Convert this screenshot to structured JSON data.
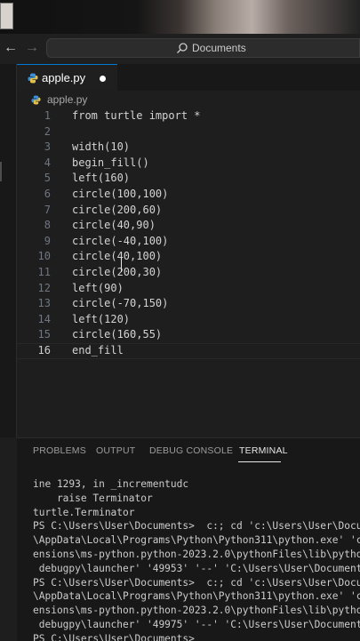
{
  "titlebar": {
    "back_icon": "arrow-left-icon",
    "forward_icon": "arrow-right-icon",
    "search_text": "Documents"
  },
  "tabs": [
    {
      "label": "apple.py",
      "modified": true
    }
  ],
  "breadcrumb": {
    "label": "apple.py"
  },
  "editor": {
    "lines": [
      {
        "n": "1",
        "code": "from turtle import *"
      },
      {
        "n": "2",
        "code": ""
      },
      {
        "n": "3",
        "code": "width(10)"
      },
      {
        "n": "4",
        "code": "begin_fill()"
      },
      {
        "n": "5",
        "code": "left(160)"
      },
      {
        "n": "6",
        "code": "circle(100,100)"
      },
      {
        "n": "7",
        "code": "circle(200,60)"
      },
      {
        "n": "8",
        "code": "circle(40,90)"
      },
      {
        "n": "9",
        "code": "circle(-40,100)"
      },
      {
        "n": "10",
        "code": "circle(40,100)"
      },
      {
        "n": "11",
        "code": "circle(200,30)"
      },
      {
        "n": "12",
        "code": "left(90)"
      },
      {
        "n": "13",
        "code": "circle(-70,150)"
      },
      {
        "n": "14",
        "code": "left(120)"
      },
      {
        "n": "15",
        "code": "circle(160,55)"
      },
      {
        "n": "16",
        "code": "end_fill"
      }
    ],
    "active_line": "16"
  },
  "panel": {
    "tabs": [
      "PROBLEMS",
      "OUTPUT",
      "DEBUG CONSOLE",
      "TERMINAL"
    ],
    "active_tab": "TERMINAL"
  },
  "terminal": {
    "lines": [
      "ine 1293, in _incrementudc",
      "    raise Terminator",
      "turtle.Terminator",
      "PS C:\\Users\\User\\Documents>  c:; cd 'c:\\Users\\User\\Docume",
      "\\AppData\\Local\\Programs\\Python\\Python311\\python.exe' 'c:\\",
      "ensions\\ms-python.python-2023.2.0\\pythonFiles\\lib\\python\\",
      " debugpy\\launcher' '49953' '--' 'C:\\Users\\User\\Documents\\a",
      "PS C:\\Users\\User\\Documents>  c:; cd 'c:\\Users\\User\\Docume",
      "\\AppData\\Local\\Programs\\Python\\Python311\\python.exe' 'c:\\",
      "ensions\\ms-python.python-2023.2.0\\pythonFiles\\lib\\python\\",
      " debugpy\\launcher' '49975' '--' 'C:\\Users\\User\\Documents\\a",
      "PS C:\\Users\\User\\Documents> "
    ]
  },
  "colors": {
    "editor_bg": "#1e1e1e",
    "panel_bg": "#181818",
    "accent": "#0078d4"
  }
}
